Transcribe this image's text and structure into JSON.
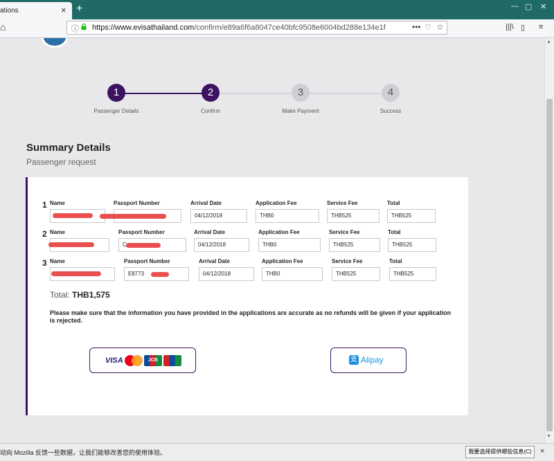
{
  "browser": {
    "tab_title": "ations",
    "tab_close": "×",
    "new_tab": "+",
    "url_domain": "https://www.evisathailand.com",
    "url_path": "/confirm/e89a6f6a8047ce40bfc9508e6004bd288e134e1f",
    "page_actions": "•••"
  },
  "steps": [
    {
      "num": "1",
      "label": "Passenger Details"
    },
    {
      "num": "2",
      "label": "Confirm"
    },
    {
      "num": "3",
      "label": "Make Payment"
    },
    {
      "num": "4",
      "label": "Success"
    }
  ],
  "summary": {
    "title": "Summary Details",
    "subtitle": "Passenger request"
  },
  "labels": {
    "name": "Name",
    "passport": "Passport Number",
    "arrival": "Arrival Date",
    "app_fee": "Application Fee",
    "service_fee": "Service Fee",
    "total": "Total"
  },
  "passengers": [
    {
      "num": "1",
      "name": "",
      "passport": "",
      "arrival": "04/12/2018",
      "app_fee": "THB0",
      "service_fee": "THB525",
      "total": "THB525"
    },
    {
      "num": "2",
      "name": "",
      "passport": "C",
      "arrival": "04/12/2018",
      "app_fee": "THB0",
      "service_fee": "THB525",
      "total": "THB525"
    },
    {
      "num": "3",
      "name": "",
      "passport": "E8773",
      "arrival": "04/12/2018",
      "app_fee": "THB0",
      "service_fee": "THB525",
      "total": "THB525"
    }
  ],
  "total": {
    "label": "Total:",
    "value": "THB1,575"
  },
  "notice": "Please make sure that the information you have provided in the applications are accurate as no refunds will be given if your application is rejected.",
  "payment": {
    "card_brands": "VISA",
    "jcb": "JCB",
    "alipay_label": "Alipay",
    "alipay_glyph": "支"
  },
  "notification": {
    "text": "动向 Mozilla 反馈一些数据，让我们能够改善您的使用体验。",
    "button": "我要选择提供哪些信息(C)",
    "close": "×"
  }
}
